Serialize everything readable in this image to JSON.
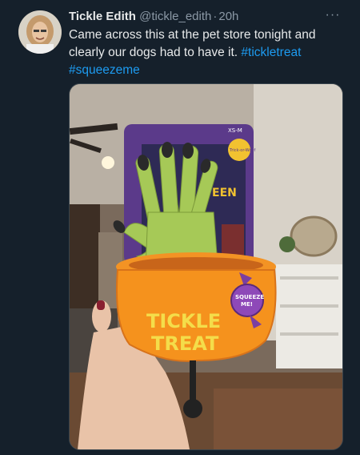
{
  "tweet": {
    "author_name": "Tickle Edith",
    "handle": "@tickle_edith",
    "separator": "·",
    "timestamp": "20h",
    "more_label": "···",
    "text_before": "Came across this at the pet store tonight and clearly our dogs had to have it.",
    "hashtags": [
      "#tickletreat",
      "#squeezeme"
    ]
  },
  "media": {
    "description_icon": "photo",
    "toy_print_line1": "TICKLE",
    "toy_print_line2": "TREAT",
    "badge_text_1": "SQUEEZE",
    "badge_text_2": "ME!",
    "card_text": "EEN",
    "card_sticker": "Trick-or-Woof",
    "card_size": "XS-M"
  },
  "colors": {
    "background": "#15202b",
    "link": "#1d9bf0",
    "muted": "#8b98a5"
  }
}
